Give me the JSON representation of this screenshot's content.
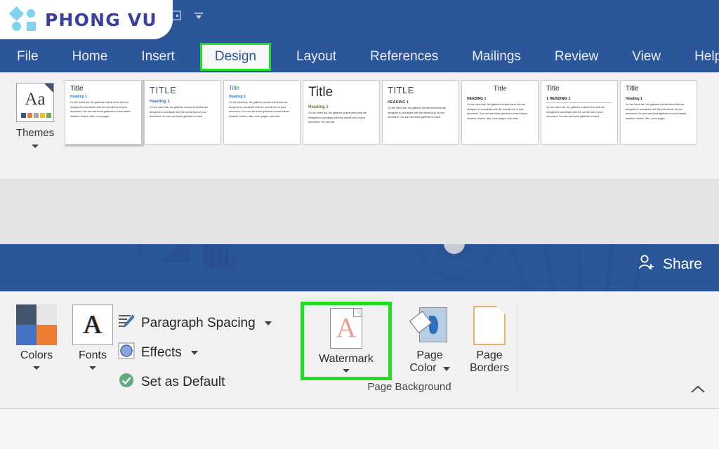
{
  "app": {
    "logo_text": "PHONG VU",
    "brand_color": "#3b3f9e",
    "logo_shape_color": "#7fd3ee",
    "ribbon_blue": "#2b579a",
    "highlight_color": "#22dd22"
  },
  "quick_access": {
    "icons": [
      "touch-mode-icon",
      "customize-quick-access-toolbar-icon"
    ]
  },
  "tabs": [
    {
      "label": "File",
      "active": false
    },
    {
      "label": "Home",
      "active": false
    },
    {
      "label": "Insert",
      "active": false
    },
    {
      "label": "Design",
      "active": true
    },
    {
      "label": "Layout",
      "active": false
    },
    {
      "label": "References",
      "active": false
    },
    {
      "label": "Mailings",
      "active": false
    },
    {
      "label": "Review",
      "active": false
    },
    {
      "label": "View",
      "active": false
    },
    {
      "label": "Help",
      "active": false
    }
  ],
  "share": {
    "label": "Share",
    "icon": "person-add-icon"
  },
  "themes": {
    "label": "Themes",
    "icon": "themes-aa-icon",
    "icon_text": "Aa",
    "swatch_colors": [
      "#2f5597",
      "#ed7d31",
      "#a5a5a5",
      "#ffc000",
      "#70ad47"
    ]
  },
  "style_gallery": {
    "selected_index": 0,
    "thumbnails": [
      {
        "title": "Title",
        "title_style": "plain-left",
        "heading": "Heading 1",
        "heading_color": "#2e74b5",
        "body": "On the Insert tab, the galleries include items that are designed to coordinate with the overall look of your document. You can use these galleries to insert tables, headers, footers, lists, cover pages"
      },
      {
        "title": "TITLE",
        "title_style": "caps-blue-gray",
        "heading": "Heading 1",
        "heading_color": "#2e74b5",
        "body": "On the Insert tab, the galleries include items that are designed to coordinate with the overall look of your document. You can use these galleries to insert"
      },
      {
        "title": "Title",
        "title_style": "small-blue",
        "heading": "Heading 1",
        "heading_color": "#2e74b5",
        "body": "On the Insert tab, the galleries include items that are designed to coordinate with the overall look of your document. You can use these galleries to insert tables, headers, footers, lists, cover pages, and other"
      },
      {
        "title": "Title",
        "title_style": "large-thin",
        "heading": "Heading 1",
        "heading_color": "#538135",
        "body": "On the Insert tab, the galleries include items that are designed to coordinate with the overall look of your document. You can use"
      },
      {
        "title": "TITLE",
        "title_style": "caps-gray",
        "heading": "HEADING 1",
        "heading_color": "#404040",
        "body": "On the Insert tab, the galleries include items that are designed to coordinate with the overall look of your document. You can use these galleries to insert"
      },
      {
        "title": "Title",
        "title_style": "centered-serif",
        "heading": "HEADING 1",
        "heading_color": "#202020",
        "body": "On the Insert tab, the galleries include items that are designed to coordinate with the overall look of your document. You can use these galleries to insert tables, headers, footers, lists, cover pages, and other"
      },
      {
        "title": "Title",
        "title_style": "numbered",
        "heading": "1   HEADING 1",
        "heading_color": "#202020",
        "body": "On the Insert tab, the galleries include items that are designed to coordinate with the overall look of your document. You can use these galleries to insert"
      },
      {
        "title": "Title",
        "title_style": "plain-left",
        "heading": "Heading 1",
        "heading_color": "#202020",
        "body": "On the Insert tab, the galleries include items that are designed to coordinate with the overall look of your document. You can use these galleries to insert tables, headers, footers, lists, cover pages"
      }
    ]
  },
  "document_formatting_group": {
    "colors": {
      "label": "Colors",
      "icon": "color-swatch-icon",
      "quadrant_colors": [
        "#44546a",
        "#e7e6e6",
        "#4472c4",
        "#ed7d31"
      ]
    },
    "fonts": {
      "label": "Fonts",
      "icon": "font-a-icon",
      "icon_text": "A"
    },
    "paragraph_spacing": {
      "label": "Paragraph Spacing",
      "icon": "paragraph-spacing-icon",
      "has_dropdown": true
    },
    "effects": {
      "label": "Effects",
      "icon": "effects-circle-icon",
      "has_dropdown": true
    },
    "set_as_default": {
      "label": "Set as Default",
      "icon": "green-check-icon"
    }
  },
  "page_background_group": {
    "label": "Page Background",
    "watermark": {
      "label": "Watermark",
      "icon": "watermark-page-icon",
      "icon_text": "A",
      "highlighted": true,
      "has_dropdown": true
    },
    "page_color": {
      "label_line1": "Page",
      "label_line2": "Color",
      "icon": "paint-bucket-page-icon",
      "has_dropdown": true
    },
    "page_borders": {
      "label_line1": "Page",
      "label_line2": "Borders",
      "icon": "page-border-icon"
    }
  },
  "collapse_ribbon": {
    "icon": "chevron-up-icon",
    "glyph": "⌃"
  }
}
